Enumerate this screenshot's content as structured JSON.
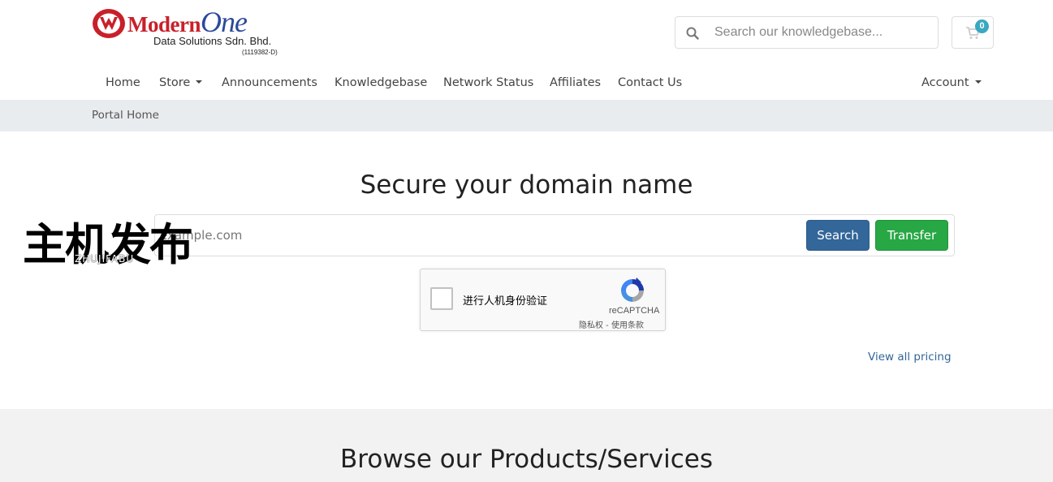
{
  "brand": {
    "name_part1": "Modern",
    "name_part2": "One",
    "company": "Data Solutions Sdn. Bhd.",
    "registration": "(1119382-D)",
    "colors": {
      "primary_red": "#c8202a",
      "primary_blue": "#2a4a9a"
    }
  },
  "header": {
    "kb_search": {
      "placeholder": "Search our knowledgebase...",
      "icon": "search-icon"
    },
    "cart": {
      "icon": "cart-icon",
      "count": "0"
    }
  },
  "nav": {
    "items": [
      {
        "label": "Home"
      },
      {
        "label": "Store",
        "dropdown": true
      },
      {
        "label": "Announcements"
      },
      {
        "label": "Knowledgebase"
      },
      {
        "label": "Network Status"
      },
      {
        "label": "Affiliates"
      },
      {
        "label": "Contact Us"
      }
    ],
    "account": {
      "label": "Account",
      "dropdown": true
    }
  },
  "breadcrumb": {
    "label": "Portal Home"
  },
  "domain": {
    "title": "Secure your domain name",
    "placeholder": "example.com",
    "search_label": "Search",
    "transfer_label": "Transfer",
    "view_pricing": "View all pricing",
    "colors": {
      "search": "#336699",
      "transfer": "#28a745"
    }
  },
  "recaptcha": {
    "label": "进行人机身份验证",
    "brand": "reCAPTCHA",
    "links": "隐私权 - 使用条款"
  },
  "products": {
    "title": "Browse our Products/Services"
  },
  "watermark": {
    "cn": "主机发布",
    "en": "ZHUJIFABU"
  }
}
